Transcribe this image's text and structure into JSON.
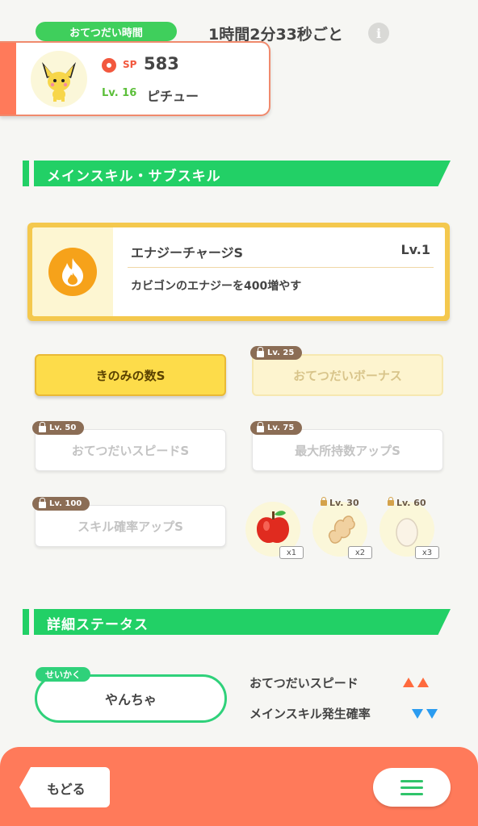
{
  "header": {
    "help_time_badge": "おてつだい時間",
    "help_time_value": "1時間2分33秒ごと",
    "info_icon": "info-icon"
  },
  "pokemon": {
    "sp_label": "SP",
    "sp_value": "583",
    "level_label": "Lv. 16",
    "name": "ピチュー"
  },
  "skills_section": {
    "title": "メインスキル・サブスキル",
    "main_skill": {
      "name": "エナジーチャージS",
      "level": "Lv.1",
      "description": "カビゴンのエナジーを400増やす",
      "icon": "fire-icon"
    },
    "sub_skills": [
      {
        "label": "きのみの数S",
        "lock": "",
        "state": "active"
      },
      {
        "label": "おてつだいボーナス",
        "lock": "Lv. 25",
        "state": "locked-gold"
      },
      {
        "label": "おてつだいスピードS",
        "lock": "Lv. 50",
        "state": "locked"
      },
      {
        "label": "最大所持数アップS",
        "lock": "Lv. 75",
        "state": "locked"
      },
      {
        "label": "スキル確率アップS",
        "lock": "Lv. 100",
        "state": "locked"
      }
    ],
    "ingredients": [
      {
        "icon": "apple-icon",
        "count": "x1",
        "lock": ""
      },
      {
        "icon": "ginger-icon",
        "count": "x2",
        "lock": "Lv. 30"
      },
      {
        "icon": "egg-icon",
        "count": "x3",
        "lock": "Lv. 60"
      }
    ]
  },
  "status_section": {
    "title": "詳細ステータス",
    "nature_tag": "せいかく",
    "nature_value": "やんちゃ",
    "stats": [
      {
        "label": "おてつだいスピード",
        "effect": "up",
        "color": "#ff6a3d"
      },
      {
        "label": "メインスキル発生確率",
        "effect": "down",
        "color": "#2b9cf0"
      }
    ]
  },
  "footer": {
    "back_label": "もどる",
    "menu_icon": "menu-icon"
  },
  "colors": {
    "accent_green": "#22d066",
    "accent_coral": "#ff7a5a",
    "gold": "#f4c84d"
  }
}
